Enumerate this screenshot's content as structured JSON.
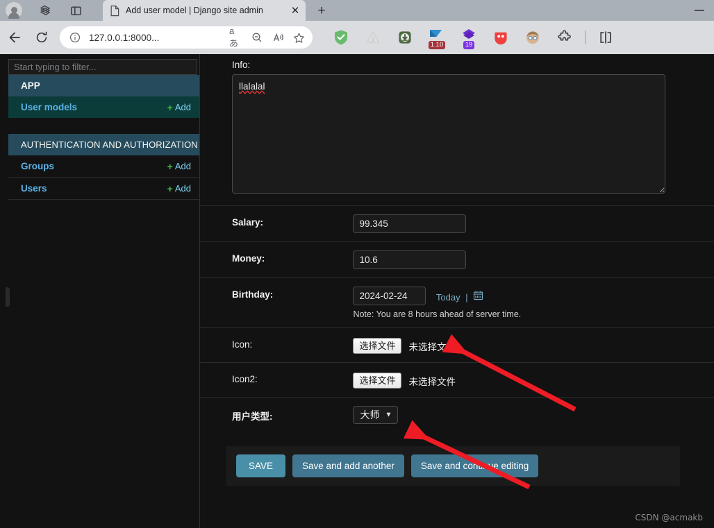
{
  "browser": {
    "tab": {
      "title": "Add user model | Django site admin",
      "favicon_icon": "document-icon",
      "close_icon": "close-icon"
    },
    "new_tab_label": "+",
    "left_icons": [
      {
        "name": "profile-avatar-icon"
      },
      {
        "name": "workspaces-icon"
      },
      {
        "name": "split-pane-icon"
      }
    ],
    "nav": {
      "back_icon": "back-arrow-icon",
      "reload_icon": "reload-icon"
    },
    "omnibox": {
      "info_icon": "site-info-icon",
      "url": "127.0.0.1:8000...",
      "translate_icon": "translate-icon",
      "zoom_out_icon": "zoom-out-icon",
      "read_aloud_icon": "read-aloud-icon",
      "favorite_icon": "star-icon"
    },
    "extensions": [
      {
        "name": "adguard-shield-icon",
        "color": "#68bb6c",
        "badge": ""
      },
      {
        "name": "triangle-extension-icon",
        "color": "#d8d8d8",
        "badge": ""
      },
      {
        "name": "download-manager-icon",
        "color": "#4f6b42",
        "badge": ""
      },
      {
        "name": "video-downloader-icon",
        "color": "#2f8fd0",
        "badge": "1.10",
        "badge_color": "#a5343c"
      },
      {
        "name": "purple-extension-icon",
        "color": "#6b2fd0",
        "badge": "19",
        "badge_color": "#7b33e0"
      },
      {
        "name": "pocket-extension-icon",
        "color": "#ef3f3f",
        "badge": ""
      },
      {
        "name": "face-avatar-extension-icon",
        "color": "#d9b48f",
        "badge": ""
      },
      {
        "name": "extensions-puzzle-icon",
        "color": "#2f3133",
        "badge": ""
      }
    ],
    "split_screen_icon": "split-screen-icon",
    "minimize_icon": "minimize-icon"
  },
  "sidebar": {
    "filter_placeholder": "Start typing to filter...",
    "groups": [
      {
        "caption": "APP",
        "caption_bold": true,
        "models": [
          {
            "label": "User models",
            "add_label": "Add",
            "current": true
          }
        ]
      },
      {
        "caption": "AUTHENTICATION AND AUTHORIZATION",
        "caption_bold": false,
        "models": [
          {
            "label": "Groups",
            "add_label": "Add",
            "current": false
          },
          {
            "label": "Users",
            "add_label": "Add",
            "current": false
          }
        ]
      }
    ],
    "add_plus_glyph": "+"
  },
  "form": {
    "info": {
      "label": "Info:",
      "value": "llalalal",
      "misspelled": true,
      "resize_handle_icon": "resize-handle-icon"
    },
    "salary": {
      "label": "Salary:",
      "value": "99.345"
    },
    "money": {
      "label": "Money:",
      "value": "10.6"
    },
    "birthday": {
      "label": "Birthday:",
      "value": "2024-02-24",
      "today_label": "Today",
      "separator": "|",
      "calendar_icon": "calendar-icon",
      "help_text": "Note: You are 8 hours ahead of server time."
    },
    "icon": {
      "label": "Icon:",
      "button_label": "选择文件",
      "status": "未选择文件"
    },
    "icon2": {
      "label": "Icon2:",
      "button_label": "选择文件",
      "status": "未选择文件"
    },
    "user_type": {
      "label": "用户类型:",
      "selected": "大师",
      "chevron_icon": "chevron-down-icon"
    }
  },
  "actions": {
    "save": "SAVE",
    "save_and_add_another": "Save and add another",
    "save_and_continue": "Save and continue editing"
  },
  "annotations": {
    "arrow_color": "#ee1c25",
    "arrows": [
      {
        "name": "arrow-to-icon-file-status"
      },
      {
        "name": "arrow-to-user-type-select"
      }
    ]
  },
  "watermark": "CSDN @acmakb",
  "colors": {
    "page_bg": "#121212",
    "sidebar_caption": "#264b5d",
    "sidebar_current_row": "#0c3c39",
    "link_blue": "#5bb3e8",
    "button_default": "#417690",
    "button_primary": "#4a8fa8"
  }
}
